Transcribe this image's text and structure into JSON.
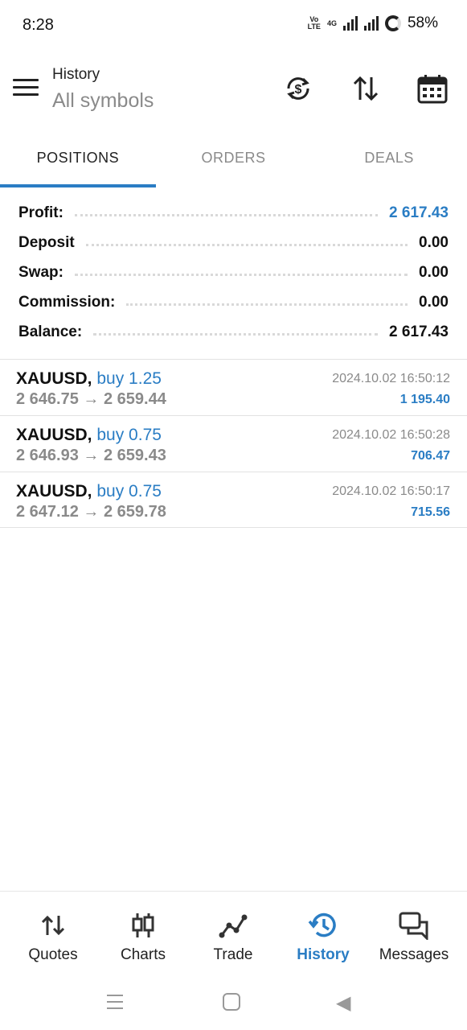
{
  "status_bar": {
    "time": "8:28",
    "volte_line1": "Vo",
    "volte_line2": "LTE",
    "network": "4G",
    "battery_percent": "58%"
  },
  "app_bar": {
    "title": "History",
    "subtitle": "All symbols",
    "icons": [
      "menu-icon",
      "currency-sync-icon",
      "sort-icon",
      "calendar-icon"
    ]
  },
  "tabs": [
    {
      "label": "POSITIONS",
      "active": true
    },
    {
      "label": "ORDERS",
      "active": false
    },
    {
      "label": "DEALS",
      "active": false
    }
  ],
  "summary": [
    {
      "label": "Profit:",
      "value": "2 617.43",
      "highlight": true
    },
    {
      "label": "Deposit",
      "value": "0.00",
      "highlight": false
    },
    {
      "label": "Swap:",
      "value": "0.00",
      "highlight": false
    },
    {
      "label": "Commission:",
      "value": "0.00",
      "highlight": false
    },
    {
      "label": "Balance:",
      "value": "2 617.43",
      "highlight": false
    }
  ],
  "positions": [
    {
      "symbol": "XAUUSD,",
      "side": "buy 1.25",
      "open_price": "2 646.75",
      "arrow": "→",
      "close_price": "2 659.44",
      "time": "2024.10.02 16:50:12",
      "profit": "1 195.40"
    },
    {
      "symbol": "XAUUSD,",
      "side": "buy 0.75",
      "open_price": "2 646.93",
      "arrow": "→",
      "close_price": "2 659.43",
      "time": "2024.10.02 16:50:28",
      "profit": "706.47"
    },
    {
      "symbol": "XAUUSD,",
      "side": "buy 0.75",
      "open_price": "2 647.12",
      "arrow": "→",
      "close_price": "2 659.78",
      "time": "2024.10.02 16:50:17",
      "profit": "715.56"
    }
  ],
  "bottom_nav": [
    {
      "label": "Quotes",
      "icon": "quotes-icon",
      "active": false
    },
    {
      "label": "Charts",
      "icon": "charts-icon",
      "active": false
    },
    {
      "label": "Trade",
      "icon": "trade-icon",
      "active": false
    },
    {
      "label": "History",
      "icon": "history-icon",
      "active": true
    },
    {
      "label": "Messages",
      "icon": "messages-icon",
      "active": false
    }
  ],
  "colors": {
    "accent": "#2a7dc4",
    "muted_text": "#8a8a8a",
    "primary_text": "#111111"
  }
}
